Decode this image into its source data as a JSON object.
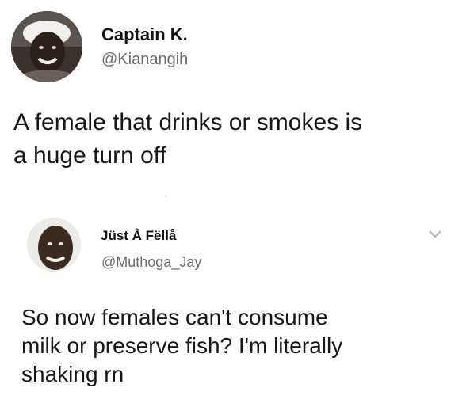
{
  "original_tweet": {
    "display_name": "Captain K.",
    "handle": "@Kianangih",
    "text": "A female that drinks or smokes is\na huge turn off",
    "avatar_icon": "profile-photo-icon"
  },
  "reply_tweet": {
    "display_name": "Jüst Å Fëllå",
    "handle": "@Muthoga_Jay",
    "text": "So now females can't consume\nmilk or preserve fish? I'm literally\nshaking rn",
    "avatar_icon": "profile-photo-icon",
    "menu_icon": "chevron-down-icon"
  },
  "colors": {
    "text": "#161616",
    "handle": "#6c6c6c",
    "chevron": "#b5b5b5"
  }
}
